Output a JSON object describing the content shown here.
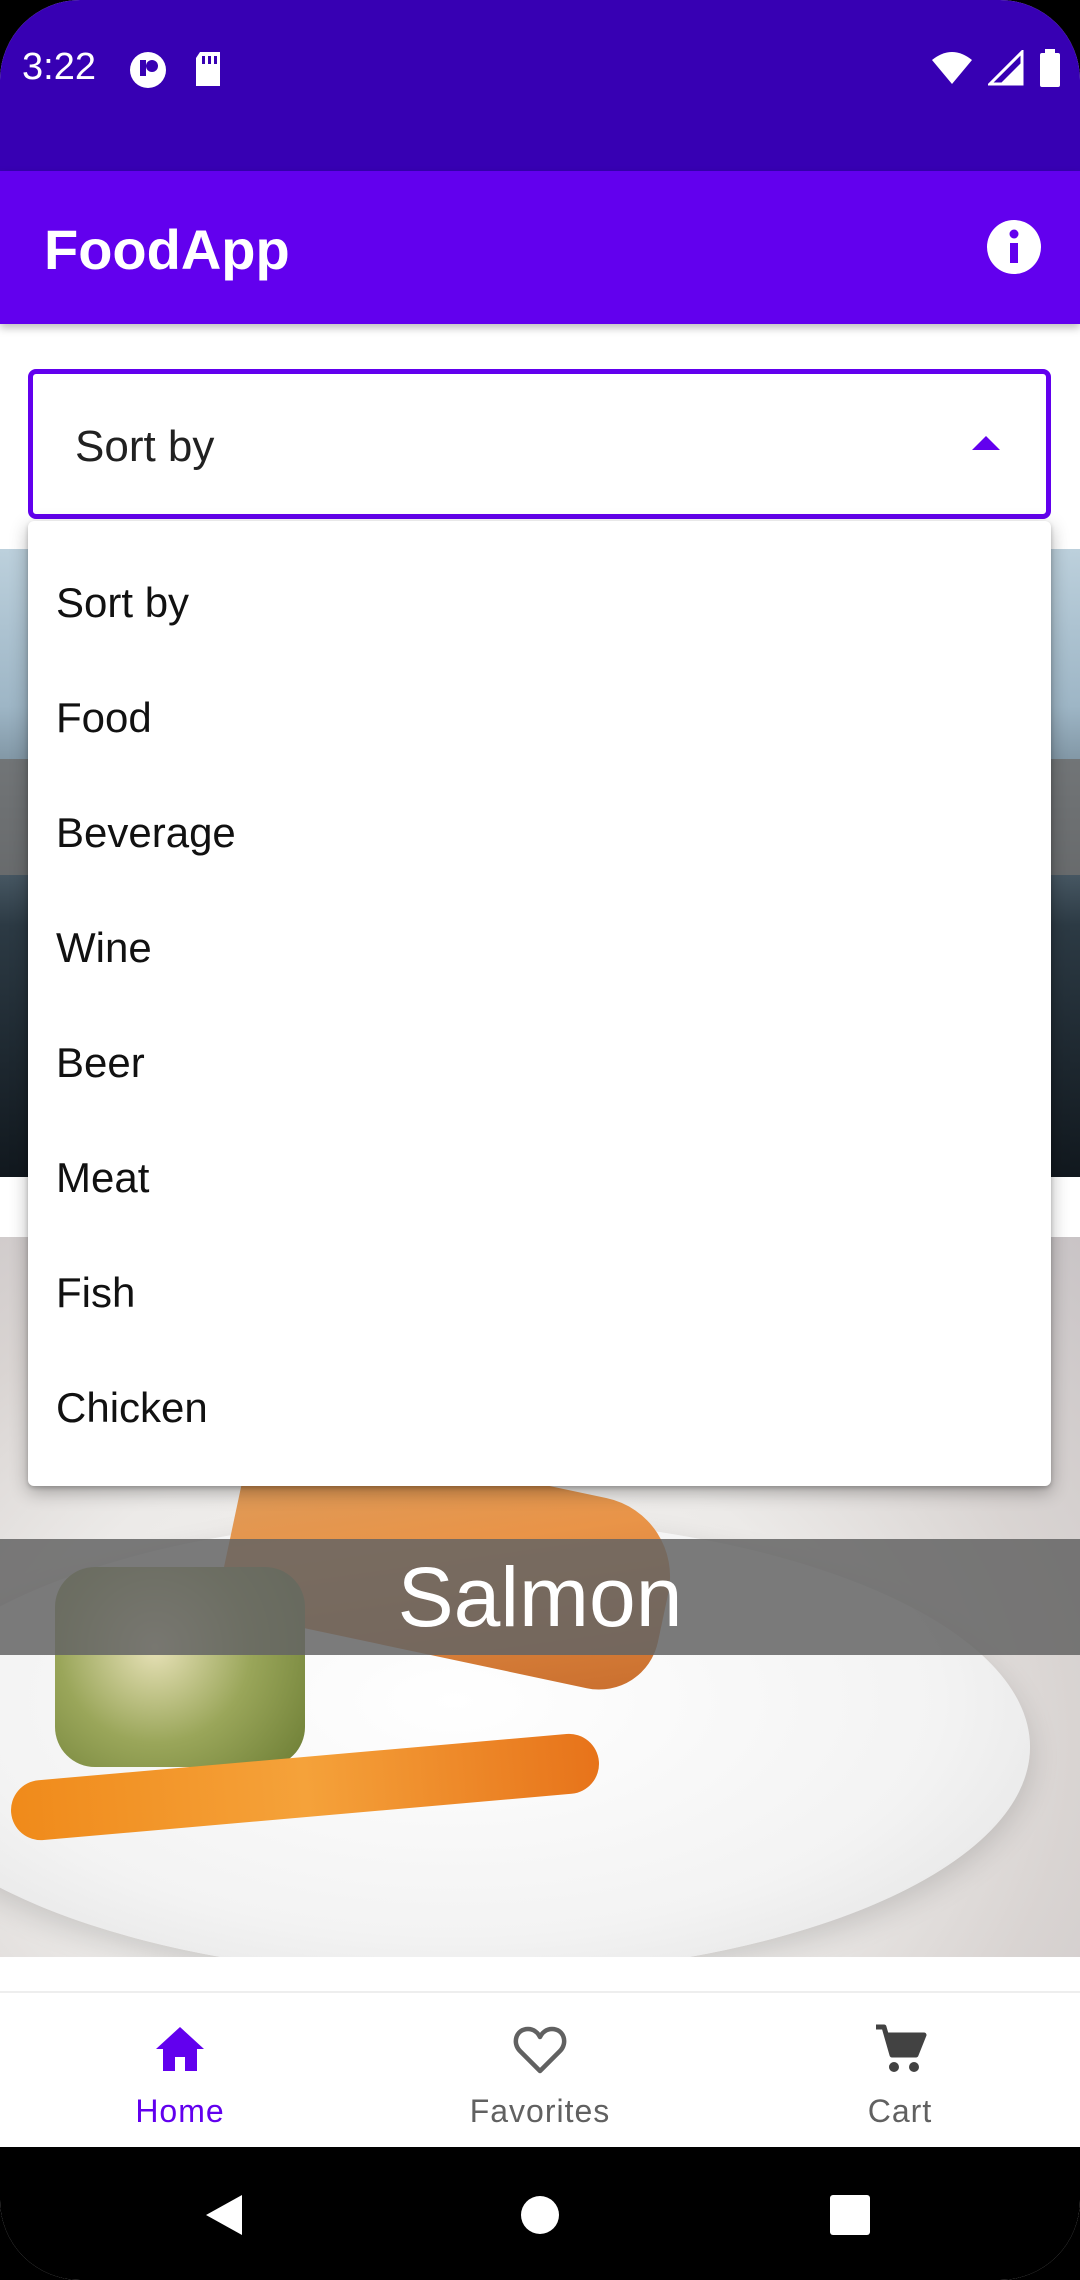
{
  "status_bar": {
    "time": "3:22",
    "left_icons": [
      "notification-icon",
      "sd-card-icon"
    ],
    "right_icons": [
      "wifi-icon",
      "signal-icon",
      "battery-icon"
    ]
  },
  "app_bar": {
    "title": "FoodApp",
    "action_icon": "info-icon"
  },
  "spinner": {
    "selected": "Sort by",
    "arrow_icon": "arrow-up-icon"
  },
  "dropdown": {
    "options": [
      "Sort by",
      "Food",
      "Beverage",
      "Wine",
      "Beer",
      "Meat",
      "Fish",
      "Chicken"
    ]
  },
  "cards": [
    {
      "title": "Salmon"
    }
  ],
  "bottom_nav": {
    "items": [
      {
        "label": "Home",
        "icon": "home-icon",
        "active": true
      },
      {
        "label": "Favorites",
        "icon": "heart-icon",
        "active": false
      },
      {
        "label": "Cart",
        "icon": "cart-icon",
        "active": false
      }
    ]
  },
  "system_nav": {
    "buttons": [
      "back-icon",
      "home-circle-icon",
      "recents-icon"
    ]
  },
  "colors": {
    "primary": "#6200ee",
    "primary_dark": "#3700b3",
    "nav_active": "#6200ee",
    "nav_inactive": "#616161"
  }
}
